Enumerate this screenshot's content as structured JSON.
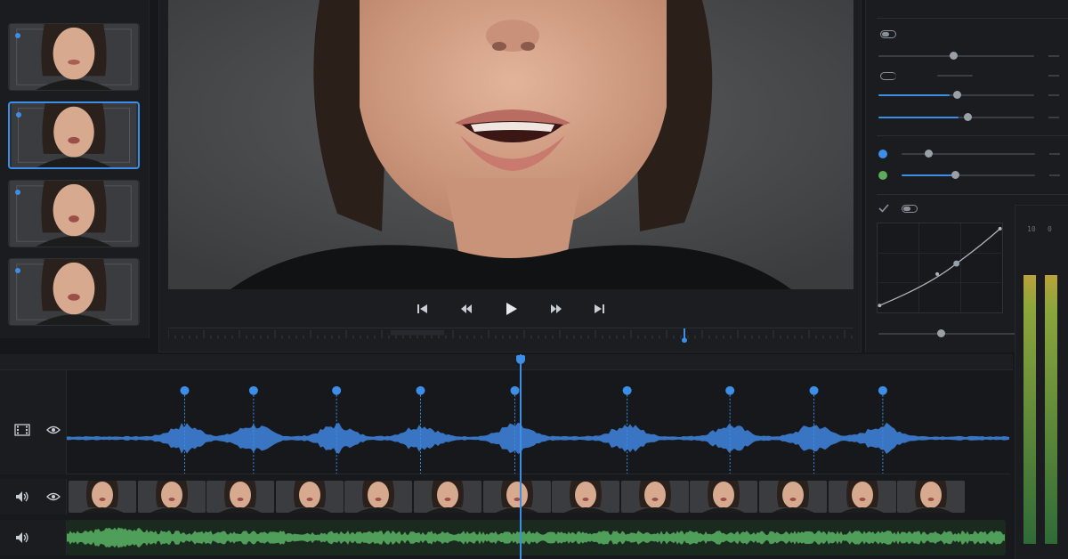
{
  "app": {
    "panels": {
      "clip_list": "clip-list",
      "viewer": "viewer",
      "inspector": "inspector",
      "timeline": "timeline"
    }
  },
  "clips": [
    {
      "name": "clip-1",
      "selected": false
    },
    {
      "name": "clip-2",
      "selected": true
    },
    {
      "name": "clip-3",
      "selected": false
    },
    {
      "name": "clip-4",
      "selected": false
    }
  ],
  "transport": {
    "buttons": [
      "skip-to-start",
      "rewind",
      "play",
      "fast-forward",
      "skip-to-end"
    ]
  },
  "inspector": {
    "sliders_top": [
      {
        "name": "param-1",
        "value": 0.45,
        "filled": false
      },
      {
        "name": "param-2",
        "value": 0.47,
        "filled": true
      },
      {
        "name": "param-3",
        "value": 0.53,
        "filled": true
      }
    ],
    "color_sliders": [
      {
        "name": "blue-channel",
        "color": "#3d8ee6",
        "value": 0.22
      },
      {
        "name": "green-channel",
        "color": "#5dab5d",
        "value": 0.44
      }
    ],
    "curve_slider": {
      "name": "curve-amount",
      "value": 0.33
    }
  },
  "meter": {
    "labels": [
      "10",
      "0"
    ],
    "left_level": 0.97,
    "right_level": 0.97
  },
  "colors": {
    "accent": "#3d8ee6",
    "audio_green": "#4f9e5a",
    "waveform_blue": "#3d7fd6"
  },
  "timeline": {
    "marker_positions": [
      0.125,
      0.198,
      0.286,
      0.375,
      0.475,
      0.594,
      0.703,
      0.792,
      0.865
    ],
    "playhead": 0.479,
    "filmstrip_frames": 13
  },
  "icons": {
    "video_track": "film-icon",
    "audio_track": "speaker-icon",
    "visibility": "eye-icon",
    "curve_enable": "checkmark-icon"
  }
}
